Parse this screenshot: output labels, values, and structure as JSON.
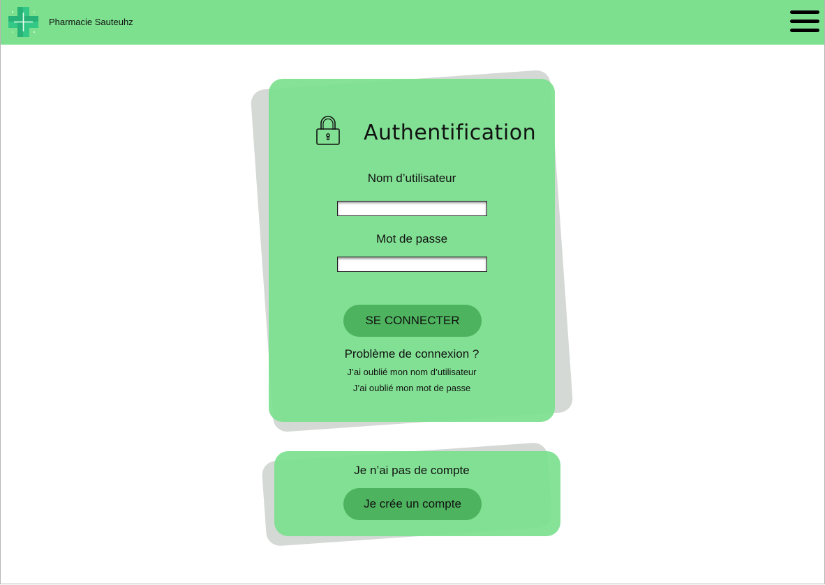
{
  "header": {
    "brand": "Pharmacie Sauteuhz",
    "logo_icon": "pharmacy-cross-icon",
    "menu_icon": "hamburger-menu-icon"
  },
  "login": {
    "title": "Authentification",
    "title_icon": "lock-icon",
    "username_label": "Nom d’utilisateur",
    "username_value": "",
    "password_label": "Mot de passe",
    "password_value": "",
    "submit_label": "SE CONNECTER",
    "problem_heading": "Problème de connexion ?",
    "forgot_username": "J’ai oublié mon nom d’utilisateur",
    "forgot_password": "J’ai oublié mon mot de passe"
  },
  "signup": {
    "prompt": "Je n’ai pas de compte",
    "button_label": "Je crée un compte"
  },
  "colors": {
    "topbar": "#7ce08f",
    "card": "#7ce08f",
    "button": "#4db35e",
    "shadow_card": "#d5d9d5",
    "logo_cross": "#2ecc8a"
  }
}
